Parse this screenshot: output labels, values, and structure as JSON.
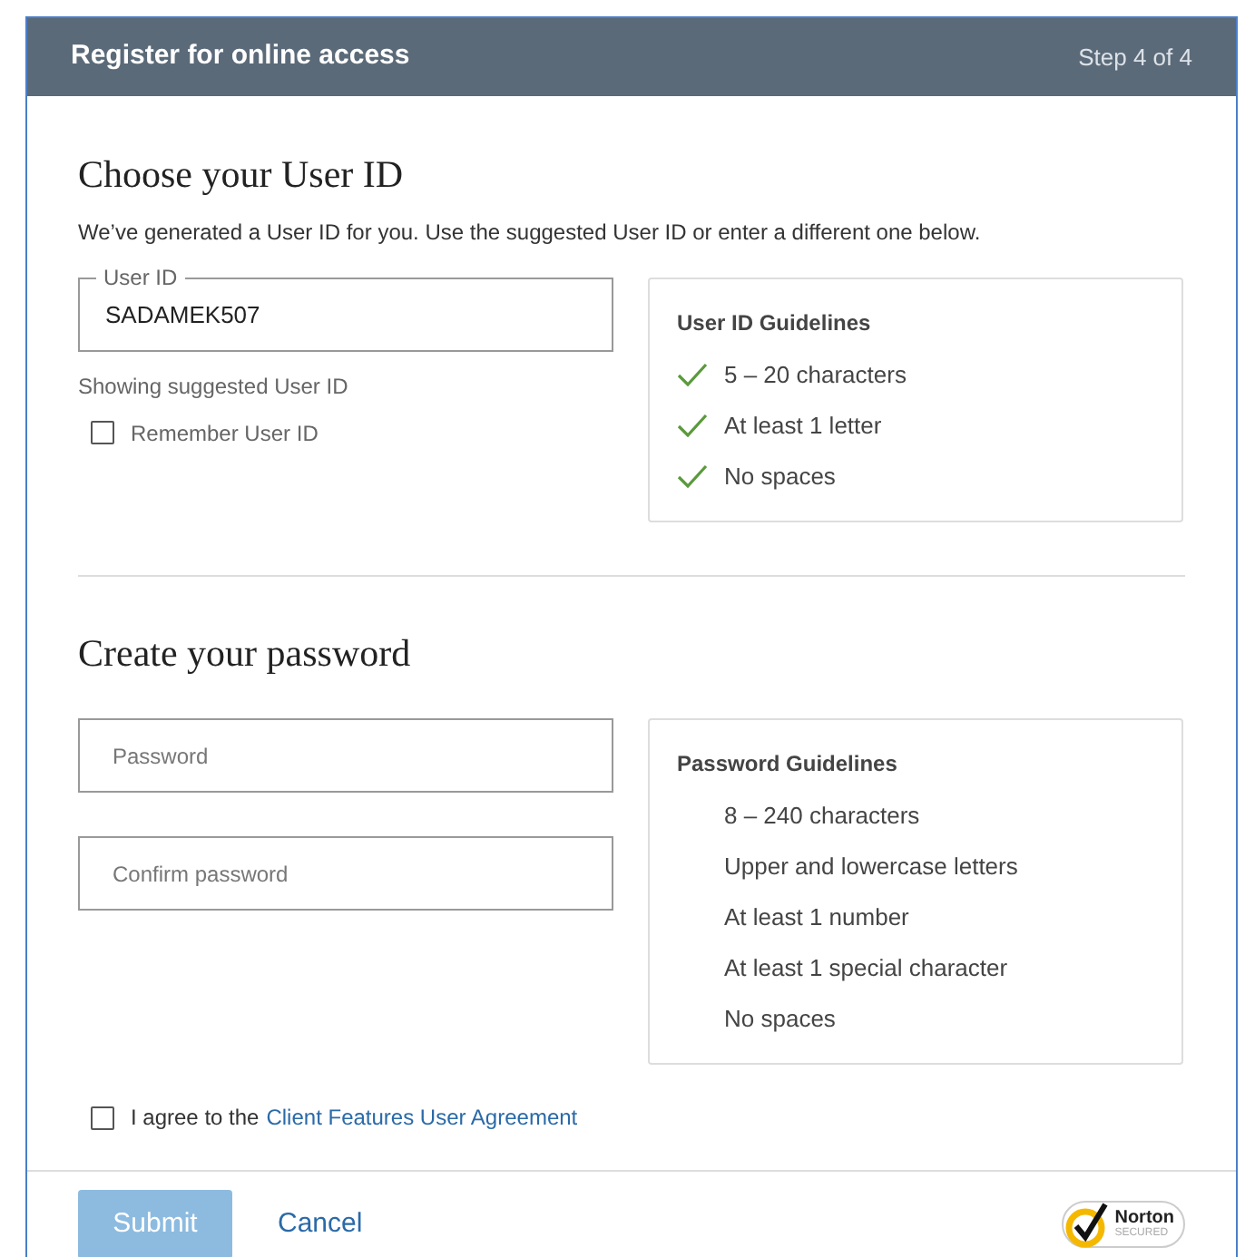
{
  "header": {
    "title": "Register for online access",
    "step": "Step 4 of 4"
  },
  "user_id_section": {
    "heading": "Choose your User ID",
    "description": "We’ve generated a User ID for you. Use the suggested User ID or enter a different one below.",
    "field": {
      "label": "User ID",
      "value": "SADAMEK507"
    },
    "hint": "Showing suggested User ID",
    "remember": {
      "label": "Remember User ID",
      "checked": false
    },
    "guidelines": {
      "title": "User ID Guidelines",
      "items": [
        {
          "text": "5 – 20 characters",
          "met": true
        },
        {
          "text": "At least 1 letter",
          "met": true
        },
        {
          "text": "No spaces",
          "met": true
        }
      ]
    }
  },
  "password_section": {
    "heading": "Create your password",
    "fields": [
      {
        "placeholder": "Password"
      },
      {
        "placeholder": "Confirm password"
      }
    ],
    "guidelines": {
      "title": "Password Guidelines",
      "items": [
        {
          "text": "8 – 240 characters",
          "met": false
        },
        {
          "text": "Upper and lowercase letters",
          "met": false
        },
        {
          "text": "At least 1 number",
          "met": false
        },
        {
          "text": "At least 1 special character",
          "met": false
        },
        {
          "text": "No spaces",
          "met": false
        }
      ]
    }
  },
  "agreement": {
    "prefix": "I agree to the",
    "link": "Client Features User Agreement",
    "checked": false
  },
  "footer": {
    "submit": {
      "label": "Submit",
      "disabled": true
    },
    "cancel": "Cancel",
    "badge": {
      "name": "Norton",
      "subtitle": "SECURED"
    }
  }
}
